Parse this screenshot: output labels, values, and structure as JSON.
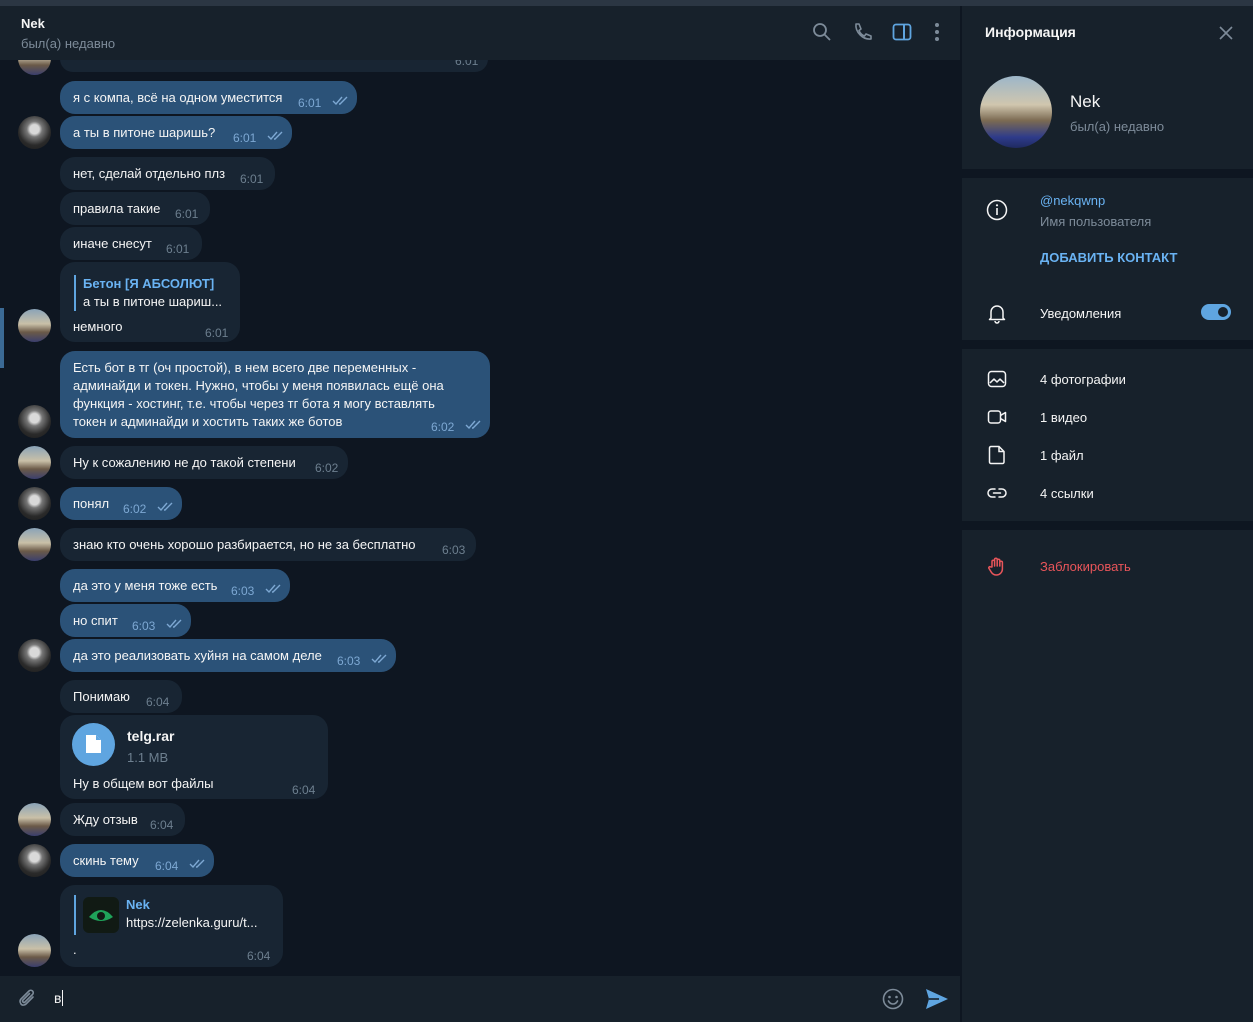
{
  "header": {
    "name": "Nek",
    "status": "был(а) недавно"
  },
  "messages": [
    {
      "text": "",
      "time": "6:01"
    },
    {
      "text": "я с компа, всё на одном уместится",
      "time": "6:01"
    },
    {
      "text": "а ты в питоне шаришь?",
      "time": "6:01"
    },
    {
      "text": "нет, сделай отдельно плз",
      "time": "6:01"
    },
    {
      "text": "правила такие",
      "time": "6:01"
    },
    {
      "text": "иначе снесут",
      "time": "6:01"
    },
    {
      "reply_name": "Бетон [Я АБСОЛЮТ]",
      "reply_text": "а ты в питоне шариш...",
      "text": "немного",
      "time": "6:01"
    },
    {
      "lines": [
        "Есть бот в тг (оч простой), в нем всего две переменных -",
        "админайди и токен. Нужно, чтобы у меня появилась ещё она",
        "функция - хостинг, т.е. чтобы через тг бота я могу вставлять",
        "токен и админайди и хостить таких же ботов"
      ],
      "time": "6:02"
    },
    {
      "text": "Ну к сожалению не до такой степени",
      "time": "6:02"
    },
    {
      "text": "понял",
      "time": "6:02"
    },
    {
      "text": "знаю кто очень хорошо разбирается, но не за бесплатно",
      "time": "6:03"
    },
    {
      "text": "да это у меня тоже есть",
      "time": "6:03"
    },
    {
      "text": "но спит",
      "time": "6:03"
    },
    {
      "text": "да это реализовать хуйня на самом деле",
      "time": "6:03"
    },
    {
      "text": "Понимаю",
      "time": "6:04"
    },
    {
      "file_name": "telg.rar",
      "file_size": "1.1 MB",
      "text": "Ну в общем вот файлы",
      "time": "6:04"
    },
    {
      "text": "Жду отзыв",
      "time": "6:04"
    },
    {
      "text": "скинь тему",
      "time": "6:04"
    },
    {
      "preview_name": "Nek",
      "preview_url": "https://zelenka.guru/t...",
      "text": ".",
      "time": "6:04"
    }
  ],
  "composer": {
    "input_value": "в"
  },
  "sidebar": {
    "title": "Информация",
    "name": "Nek",
    "status": "был(а) недавно",
    "username": "@nekqwnp",
    "username_label": "Имя пользователя",
    "add_contact": "ДОБАВИТЬ КОНТАКТ",
    "notifications": "Уведомления",
    "notifications_enabled": true,
    "media": [
      {
        "label": "4 фотографии",
        "icon": "photo-icon"
      },
      {
        "label": "1 видео",
        "icon": "video-icon"
      },
      {
        "label": "1 файл",
        "icon": "file-icon"
      },
      {
        "label": "4 ссылки",
        "icon": "link-icon"
      }
    ],
    "block": "Заблокировать"
  },
  "colors": {
    "chat_bg": "#0e1621",
    "panel_bg": "#17212b",
    "bubble_in": "#182533",
    "bubble_out": "#2b5278",
    "accent": "#6ab3f3",
    "danger": "#e8555a"
  }
}
